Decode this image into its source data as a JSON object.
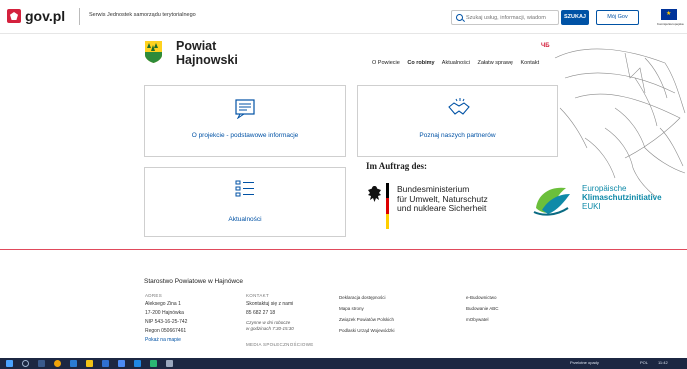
{
  "govbar": {
    "brand": "gov.pl",
    "subtitle": "Serwis Jednostek samorządu terytorialnego",
    "search_placeholder": "Szukaj usług, informacji, wiadom",
    "search_button": "SZUKAJ",
    "account_button": "Mój Gov",
    "eu_caption": "Komisja Europejska"
  },
  "header": {
    "title_line1": "Powiat",
    "title_line2": "Hajnowski",
    "lang": "ЧБ",
    "nav": [
      "O Powiecie",
      "Co robimy",
      "Aktualności",
      "Załatw sprawę",
      "Kontakt"
    ],
    "active_nav": "Co robimy"
  },
  "cards": [
    {
      "label": "O projekcie - podstawowe informacje",
      "icon": "document-icon"
    },
    {
      "label": "Poznaj naszych partnerów",
      "icon": "handshake-icon"
    },
    {
      "label": "Aktualności",
      "icon": "news-list-icon"
    }
  ],
  "funding": {
    "heading": "Im Auftrag des:",
    "ministry_line1": "Bundesministerium",
    "ministry_line2": "für Umwelt, Naturschutz",
    "ministry_line3": "und nukleare Sicherheit",
    "euki_line1": "Europäische",
    "euki_line2": "Klimaschutzinitiative",
    "euki_line3": "EUKI"
  },
  "footer": {
    "title": "Starostwo Powiatowe w Hajnówce",
    "address_heading": "ADRES",
    "address_lines": [
      "Aleksego Zina 1",
      "17-200 Hajnówka",
      "NIP 543-16-25-742",
      "Regon 050667461"
    ],
    "address_link": "Pokaż na mapie",
    "contact_heading": "KONTAKT",
    "contact_line1": "Skontaktuj się z nami",
    "contact_phone": "85 682 27 18",
    "contact_hours_line1": "Czynne w dni robocze",
    "contact_hours_line2": "w godzinach 7:30-15:30",
    "contact_more": "MEDIA SPOŁECZNOŚCIOWE",
    "links_col1": [
      "Deklaracja dostępności",
      "Mapa strony",
      "Związek Powiatów Polskich",
      "Podlaski Urząd Wojewódzki"
    ],
    "links_col2": [
      "e-Budownictwo",
      "Budowanie ABC",
      "mObywatel"
    ]
  },
  "taskbar": {
    "weather_text": "Przelotne opady",
    "lang": "POL",
    "time": "11:42"
  }
}
